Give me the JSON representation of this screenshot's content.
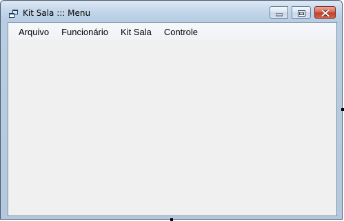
{
  "window": {
    "title": "Kit Sala ::: Menu"
  },
  "titlebar": {
    "app_icon": "windows-form-icon",
    "buttons": [
      {
        "name": "minimize",
        "icon": "minimize-icon"
      },
      {
        "name": "maximize",
        "icon": "maximize-icon"
      },
      {
        "name": "close",
        "icon": "close-icon"
      }
    ]
  },
  "menu": {
    "items": [
      {
        "label": "Arquivo"
      },
      {
        "label": "Funcionário"
      },
      {
        "label": "Kit Sala"
      },
      {
        "label": "Controle"
      }
    ]
  },
  "colors": {
    "client_background": "#f0f0f0",
    "close_button": "#c4402c",
    "frame": "#b9cde2"
  }
}
